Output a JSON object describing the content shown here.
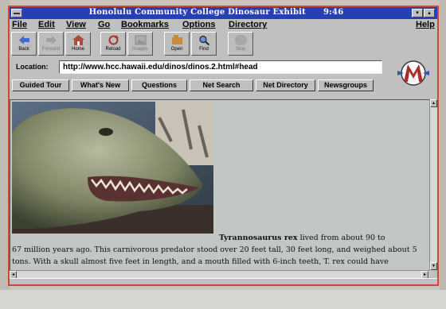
{
  "window": {
    "title": "Honolulu Community College Dinosaur Exhibit",
    "clock": "9:46",
    "sys_menu_icon": "system-menu-icon",
    "minimize_glyph": "▾",
    "maximize_glyph": "▴"
  },
  "menu": {
    "items": [
      "File",
      "Edit",
      "View",
      "Go",
      "Bookmarks",
      "Options",
      "Directory"
    ],
    "help": "Help"
  },
  "toolbar": {
    "buttons": [
      {
        "label": "Back",
        "icon": "back-arrow-icon",
        "enabled": true
      },
      {
        "label": "Forward",
        "icon": "forward-arrow-icon",
        "enabled": false
      },
      {
        "label": "Home",
        "icon": "home-icon",
        "enabled": true
      },
      {
        "label": "Reload",
        "icon": "reload-icon",
        "enabled": true
      },
      {
        "label": "Images",
        "icon": "images-icon",
        "enabled": false
      },
      {
        "label": "Open",
        "icon": "open-icon",
        "enabled": true
      },
      {
        "label": "Find",
        "icon": "find-icon",
        "enabled": true
      },
      {
        "label": "Stop",
        "icon": "stop-icon",
        "enabled": false
      }
    ]
  },
  "location": {
    "label": "Location:",
    "url": "http://www.hcc.hawaii.edu/dinos/dinos.2.html#head"
  },
  "directory_buttons": [
    "Guided Tour",
    "What's New",
    "Questions",
    "Net Search",
    "Net Directory",
    "Newsgroups"
  ],
  "content": {
    "species": "Tyrannosaurus rex",
    "first_line_rest": " lived from about 90 to",
    "paragraph": "67 million years ago. This carnivorous predator stood over 20 feet tall, 30 feet long, and weighed about 5 tons. With a skull almost five feet in length, and a mouth filled with 6-inch teeth, T. rex could have swallowed an average-sized person."
  },
  "colors": {
    "titlebar": "#2440b8",
    "window_face": "#c0c0c0",
    "content_bg": "#c2c6c4"
  }
}
